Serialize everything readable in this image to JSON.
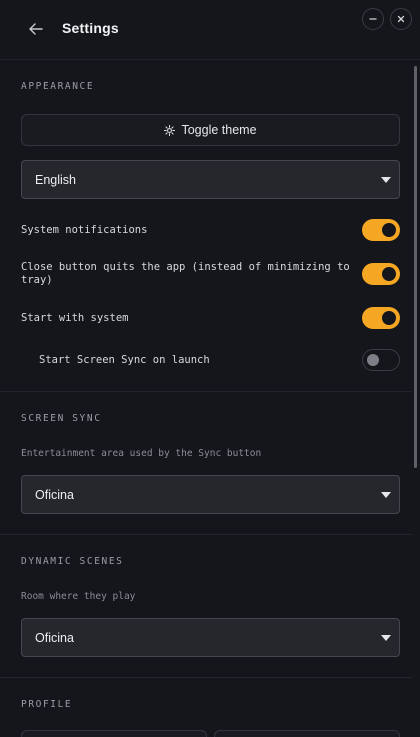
{
  "header": {
    "title": "Settings",
    "back_icon": "arrow-left-icon",
    "minimize_icon": "minus-icon",
    "close_icon": "close-icon"
  },
  "appearance": {
    "section_title": "APPEARANCE",
    "toggle_theme_label": "Toggle theme",
    "toggle_theme_icon": "sun-icon",
    "language_value": "English",
    "options": [
      {
        "label": "System notifications",
        "enabled": true
      },
      {
        "label": "Close button quits the app (instead of minimizing to tray)",
        "enabled": true
      },
      {
        "label": "Start with system",
        "enabled": true
      },
      {
        "label": "Start Screen Sync on launch",
        "enabled": false
      }
    ]
  },
  "screen_sync": {
    "section_title": "SCREEN SYNC",
    "description": "Entertainment area used by the Sync button",
    "value": "Oficina"
  },
  "dynamic_scenes": {
    "section_title": "DYNAMIC SCENES",
    "description": "Room where they play",
    "value": "Oficina"
  },
  "profile": {
    "section_title": "PROFILE"
  },
  "colors": {
    "background": "#15161b",
    "accent": "#f5a623",
    "select_bg": "#26272d"
  }
}
